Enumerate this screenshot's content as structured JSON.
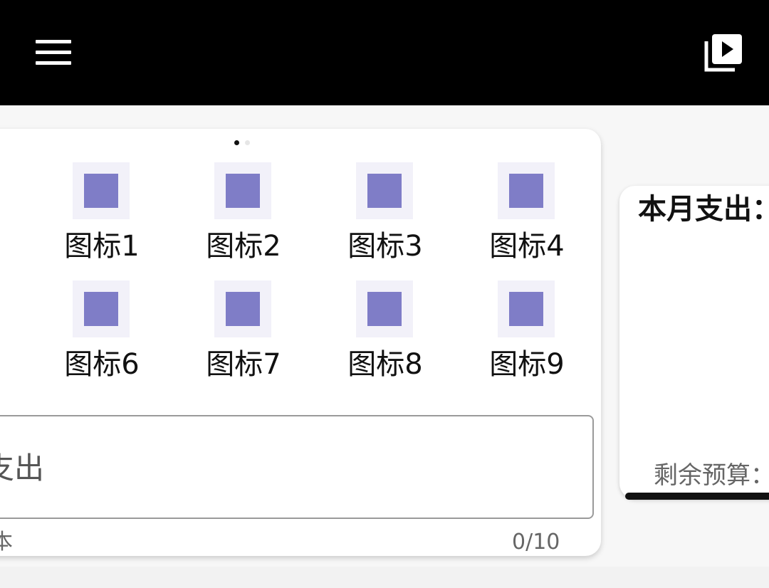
{
  "header": {
    "menu_icon": "menu-icon",
    "video_icon": "video-library-icon"
  },
  "pager": {
    "total": 2,
    "active": 0
  },
  "icons": [
    {
      "label": "图标1",
      "icon": "placeholder-square-icon"
    },
    {
      "label": "图标2",
      "icon": "placeholder-square-icon"
    },
    {
      "label": "图标3",
      "icon": "placeholder-square-icon"
    },
    {
      "label": "图标4",
      "icon": "placeholder-square-icon"
    },
    {
      "label": "图标6",
      "icon": "placeholder-square-icon"
    },
    {
      "label": "图标7",
      "icon": "placeholder-square-icon"
    },
    {
      "label": "图标8",
      "icon": "placeholder-square-icon"
    },
    {
      "label": "图标9",
      "icon": "placeholder-square-icon"
    }
  ],
  "input": {
    "text": "支出",
    "helper": "本",
    "counter": "0/10"
  },
  "side_card": {
    "title": "本月支出：",
    "remaining": "剩余预算："
  },
  "colors": {
    "topbar": "#000000",
    "icon_square": "#7f7dc7",
    "icon_tile_bg": "#f2f1f9"
  }
}
